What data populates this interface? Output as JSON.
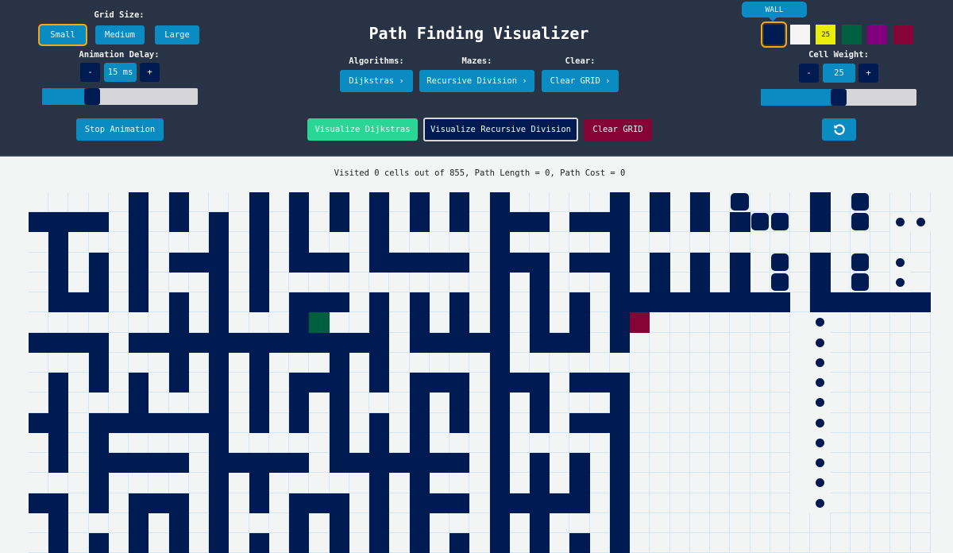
{
  "header": {
    "title": "Path Finding Visualizer",
    "grid_size": {
      "label": "Grid Size:",
      "options": [
        "Small",
        "Medium",
        "Large"
      ],
      "selected": "Small"
    },
    "animation_delay": {
      "label": "Animation Delay:",
      "decrement": "-",
      "value": "15 ms",
      "increment": "+",
      "slider_fraction": 0.3
    },
    "stop_animation": "Stop Animation",
    "algorithms": {
      "label": "Algorithms:",
      "value": "Dijkstras ›"
    },
    "mazes": {
      "label": "Mazes:",
      "value": "Recursive Division ›"
    },
    "clear": {
      "label": "Clear:",
      "value": "Clear GRID ›"
    },
    "actions": {
      "visualize_algorithm": "Visualize Dijkstras",
      "visualize_maze": "Visualize Recursive Division",
      "clear_grid": "Clear GRID"
    },
    "cell_types": {
      "tooltip": "WALL",
      "swatches": [
        {
          "name": "wall",
          "color": "#001b51",
          "label": ""
        },
        {
          "name": "empty",
          "color": "#f5f5f5",
          "label": ""
        },
        {
          "name": "weight",
          "color": "#e8ee0a",
          "label": "25"
        },
        {
          "name": "start",
          "color": "#005f3f",
          "label": ""
        },
        {
          "name": "visited",
          "color": "#800080",
          "label": ""
        },
        {
          "name": "target",
          "color": "#850435",
          "label": ""
        }
      ],
      "selected": "wall"
    },
    "cell_weight": {
      "label": "Cell Weight:",
      "decrement": "-",
      "value": "25",
      "increment": "+",
      "slider_fraction": 0.5
    },
    "reset_icon": "rotate-ccw-icon"
  },
  "status": "Visited 0 cells out of 855, Path Length = 0, Path Cost = 0",
  "grid": {
    "columns": 45,
    "total_rows": 19,
    "colors": {
      "wall": "#001b51",
      "start": "#005f3f",
      "target": "#850435",
      "empty": "#f3f4f4",
      "gridline": "#d4e6f1"
    },
    "start": [
      6,
      14
    ],
    "target": [
      6,
      30
    ],
    "rows": [
      {
        "walls": [
          5,
          7,
          11,
          13,
          15,
          17,
          19,
          21,
          23,
          29,
          31,
          33,
          39
        ],
        "anim": [
          35,
          41
        ],
        "dots": []
      },
      {
        "walls": [
          0,
          1,
          2,
          3,
          5,
          7,
          9,
          11,
          13,
          15,
          17,
          19,
          21,
          23,
          24,
          25,
          27,
          28,
          29,
          31,
          33,
          35,
          39
        ],
        "anim": [
          36,
          37,
          41
        ],
        "dots": [
          43,
          44
        ]
      },
      {
        "walls": [
          1,
          5,
          9,
          11,
          13,
          17,
          23,
          29
        ],
        "anim": [],
        "dots": []
      },
      {
        "walls": [
          1,
          3,
          5,
          7,
          8,
          9,
          11,
          13,
          14,
          15,
          17,
          18,
          19,
          20,
          21,
          23,
          24,
          25,
          27,
          28,
          29,
          31,
          33,
          35,
          39
        ],
        "anim": [
          37,
          41
        ],
        "dots": [
          43
        ]
      },
      {
        "walls": [
          1,
          3,
          5,
          9,
          11,
          23,
          25,
          29,
          31,
          33,
          35,
          39
        ],
        "anim": [
          37,
          41
        ],
        "dots": [
          43
        ]
      },
      {
        "walls": [
          1,
          2,
          3,
          5,
          7,
          9,
          11,
          13,
          14,
          15,
          17,
          19,
          21,
          23,
          25,
          27,
          29,
          30,
          31,
          32,
          33,
          34,
          35,
          36,
          37,
          39,
          40,
          41,
          42,
          43,
          44
        ],
        "anim": [],
        "dots": []
      },
      {
        "walls": [
          7,
          9,
          13,
          17,
          19,
          21,
          23,
          25,
          27,
          29
        ],
        "anim": [],
        "dots": [
          39
        ]
      },
      {
        "walls": [
          0,
          1,
          2,
          3,
          5,
          6,
          7,
          8,
          9,
          10,
          11,
          12,
          13,
          14,
          15,
          16,
          17,
          19,
          20,
          21,
          22,
          23,
          25,
          26,
          27,
          29
        ],
        "anim": [],
        "dots": [
          39
        ]
      },
      {
        "walls": [
          3,
          7,
          9,
          11,
          15,
          17,
          23
        ],
        "anim": [],
        "dots": [
          39
        ]
      },
      {
        "walls": [
          1,
          3,
          5,
          7,
          9,
          11,
          13,
          14,
          15,
          17,
          19,
          20,
          21,
          23,
          24,
          25,
          27,
          28,
          29
        ],
        "anim": [],
        "dots": [
          39
        ]
      },
      {
        "walls": [
          1,
          5,
          9,
          11,
          13,
          15,
          19,
          21,
          23,
          25,
          29
        ],
        "anim": [],
        "dots": [
          39
        ]
      },
      {
        "walls": [
          0,
          1,
          3,
          4,
          5,
          6,
          7,
          8,
          9,
          11,
          13,
          15,
          17,
          19,
          21,
          23,
          25,
          27,
          28,
          29
        ],
        "anim": [],
        "dots": [
          39
        ]
      },
      {
        "walls": [
          1,
          3,
          9,
          15,
          17,
          19,
          23,
          29
        ],
        "anim": [],
        "dots": [
          39
        ]
      },
      {
        "walls": [
          1,
          3,
          4,
          5,
          6,
          7,
          9,
          10,
          11,
          12,
          13,
          15,
          16,
          17,
          18,
          19,
          20,
          21,
          23,
          25,
          27,
          29
        ],
        "anim": [],
        "dots": [
          39
        ]
      },
      {
        "walls": [
          3,
          9,
          11,
          17,
          19,
          23,
          25,
          27,
          29
        ],
        "anim": [],
        "dots": [
          39
        ]
      },
      {
        "walls": [
          0,
          1,
          3,
          5,
          6,
          7,
          9,
          11,
          13,
          14,
          15,
          17,
          19,
          20,
          21,
          23,
          24,
          25,
          26,
          27,
          29
        ],
        "anim": [],
        "dots": [
          39
        ]
      },
      {
        "walls": [
          1,
          5,
          7,
          9,
          13,
          15,
          17,
          19,
          23,
          25,
          29
        ],
        "anim": [],
        "dots": []
      },
      {
        "walls": [
          1,
          3,
          5,
          7,
          9,
          11,
          13,
          15,
          17,
          19,
          21,
          23,
          25,
          27,
          29
        ],
        "anim": [],
        "dots": []
      }
    ]
  }
}
